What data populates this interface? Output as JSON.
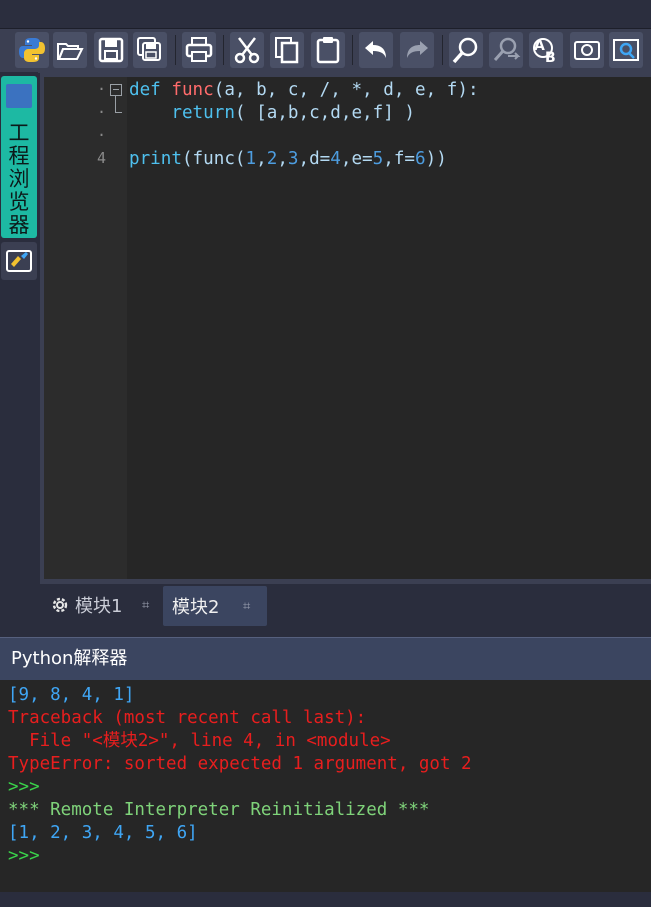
{
  "toolbar": {
    "buttons": [
      "python-logo-icon",
      "open-folder-icon",
      "save-icon",
      "save-all-icon",
      "print-icon",
      "cut-icon",
      "copy-icon",
      "paste-icon",
      "undo-icon",
      "redo-icon",
      "find-icon",
      "find-replace-icon",
      "spell-check-icon",
      "screenshot-icon",
      "zoom-icon"
    ]
  },
  "sidebar": {
    "project_browser_label": "工程浏览器"
  },
  "editor": {
    "line_numbers": [
      "·",
      "·",
      "·",
      "4"
    ],
    "code": {
      "line1": {
        "kw": "def ",
        "fn": "func",
        "rest": "(a, b, c, /, *, d, e, f):"
      },
      "line2": {
        "indent": "    ",
        "kw": "return",
        "rest": "( [a,b,c,d,e,f] )"
      },
      "line4": {
        "kw": "print",
        "p1": "(func(",
        "n1": "1",
        "c1": ",",
        "n2": "2",
        "c2": ",",
        "n3": "3",
        "c3": ",d=",
        "n4": "4",
        "c4": ",e=",
        "n5": "5",
        "c5": ",f=",
        "n6": "6",
        "c6": "))"
      }
    }
  },
  "tabs": [
    {
      "label": "模块1",
      "active": false
    },
    {
      "label": "模块2",
      "active": true
    }
  ],
  "interpreter": {
    "title": "Python解释器",
    "lines": [
      {
        "text": "[9, 8, 4, 1]",
        "color": "blue"
      },
      {
        "text": "Traceback (most recent call last):",
        "color": "red"
      },
      {
        "text": "  File \"<模块2>\", line 4, in <module>",
        "color": "red"
      },
      {
        "text": "TypeError: sorted expected 1 argument, got 2",
        "color": "red"
      },
      {
        "text": ">>>",
        "color": "green"
      },
      {
        "text": "*** Remote Interpreter Reinitialized ***",
        "color": "lightgreen"
      },
      {
        "text": "[1, 2, 3, 4, 5, 6]",
        "color": "blue"
      },
      {
        "text": ">>>",
        "color": "green"
      }
    ]
  },
  "colors": {
    "keyword": "#4ec0ee",
    "function_name": "#ff6b6b",
    "number": "#4d9de0",
    "console_error": "#e81e1e",
    "console_output": "#3fa6f5",
    "prompt": "#3ad24a"
  }
}
